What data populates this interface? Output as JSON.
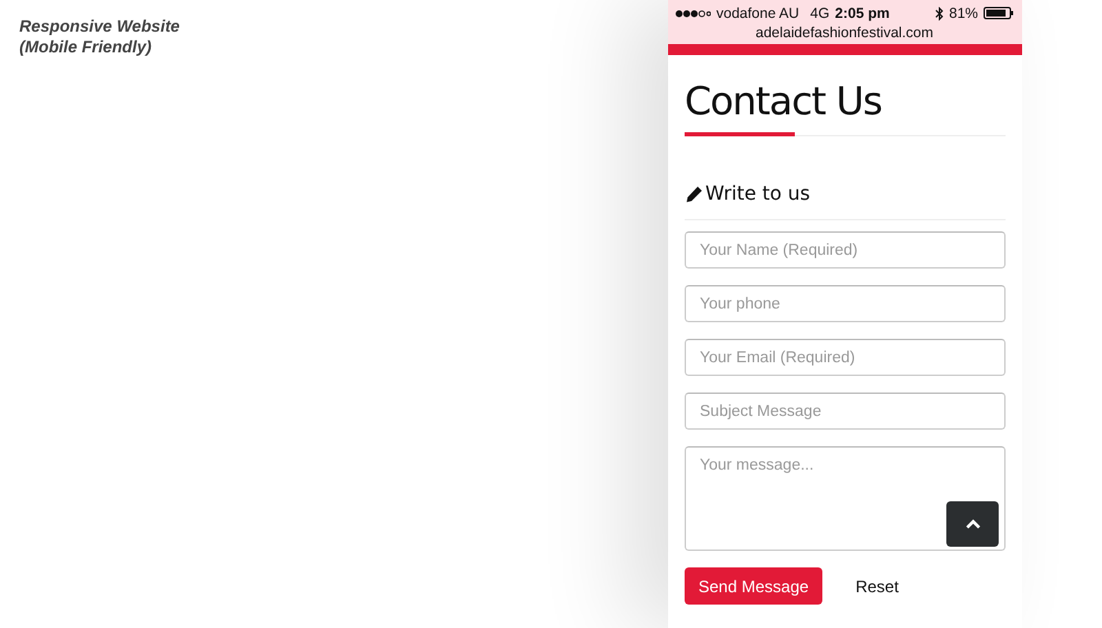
{
  "caption": [
    "Responsive Website",
    "(Mobile Friendly)"
  ],
  "status_bar": {
    "carrier": "vodafone AU",
    "network": "4G",
    "time": "2:05 pm",
    "battery": "81%",
    "url": "adelaidefashionfestival.com"
  },
  "page": {
    "title": "Contact Us",
    "section_title": "Write to us",
    "fields": [
      {
        "kind": "input",
        "placeholder": "Your Name (Required)"
      },
      {
        "kind": "input",
        "placeholder": "Your phone"
      },
      {
        "kind": "input",
        "placeholder": "Your Email (Required)"
      },
      {
        "kind": "input",
        "placeholder": "Subject Message"
      },
      {
        "kind": "textarea",
        "placeholder": "Your message..."
      }
    ],
    "buttons": [
      {
        "kind": "primary",
        "label": "Send Message"
      },
      {
        "kind": "plain",
        "label": "Reset"
      }
    ]
  }
}
